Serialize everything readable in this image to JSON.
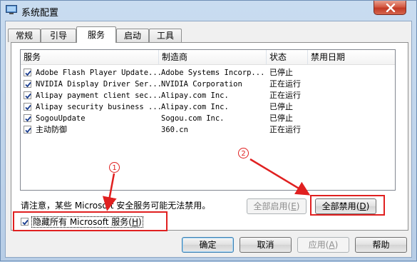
{
  "window": {
    "title": "系统配置",
    "close_icon": "close-icon"
  },
  "tabs": [
    {
      "label": "常规",
      "active": false
    },
    {
      "label": "引导",
      "active": false
    },
    {
      "label": "服务",
      "active": true
    },
    {
      "label": "启动",
      "active": false
    },
    {
      "label": "工具",
      "active": false
    }
  ],
  "columns": {
    "service": "服务",
    "manufacturer": "制造商",
    "status": "状态",
    "disabled_date": "禁用日期"
  },
  "services": [
    {
      "name": "Adobe Flash Player Update...",
      "manufacturer": "Adobe Systems Incorp...",
      "status": "已停止",
      "disabled_date": "",
      "checked": true
    },
    {
      "name": "NVIDIA Display Driver Ser...",
      "manufacturer": "NVIDIA Corporation",
      "status": "正在运行",
      "disabled_date": "",
      "checked": true
    },
    {
      "name": "Alipay payment client sec...",
      "manufacturer": "Alipay.com Inc.",
      "status": "正在运行",
      "disabled_date": "",
      "checked": true
    },
    {
      "name": "Alipay security business ...",
      "manufacturer": "Alipay.com Inc.",
      "status": "已停止",
      "disabled_date": "",
      "checked": true
    },
    {
      "name": "SogouUpdate",
      "manufacturer": "Sogou.com Inc.",
      "status": "已停止",
      "disabled_date": "",
      "checked": true
    },
    {
      "name": "主动防御",
      "manufacturer": "360.cn",
      "status": "正在运行",
      "disabled_date": "",
      "checked": true
    }
  ],
  "note": "请注意，某些 Microsoft 安全服务可能无法禁用。",
  "enable_all": {
    "label": "全部启用",
    "key": "E"
  },
  "disable_all": {
    "label": "全部禁用",
    "key": "D"
  },
  "hide_microsoft": {
    "label": "隐藏所有 Microsoft 服务",
    "key": "H",
    "checked": true
  },
  "footer": {
    "ok": "确定",
    "cancel": "取消",
    "apply": "应用",
    "apply_key": "A",
    "help": "帮助"
  },
  "annotations": {
    "marker_1": "1",
    "marker_2": "2",
    "color": "#e02020"
  }
}
